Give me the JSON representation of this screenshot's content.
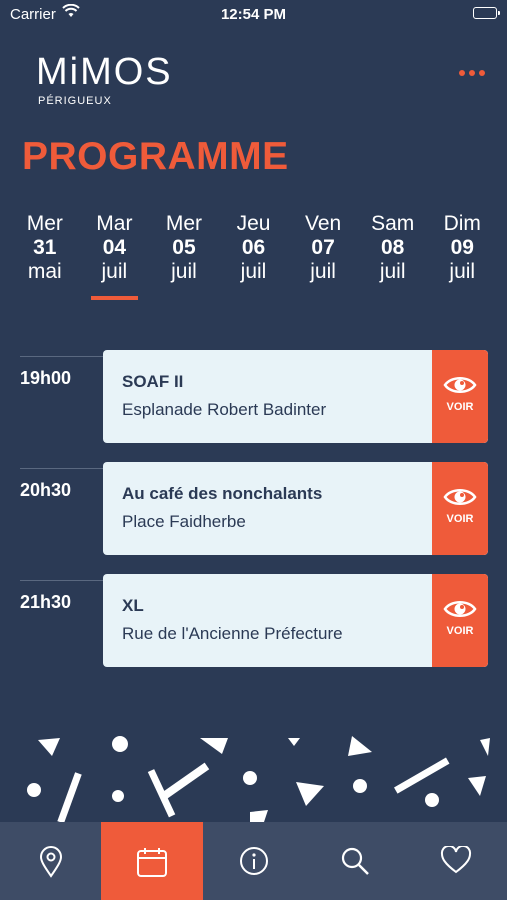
{
  "status_bar": {
    "carrier": "Carrier",
    "time": "12:54 PM"
  },
  "logo": {
    "word": "MiMOS",
    "sub": "PÉRIGUEUX"
  },
  "page_title": "PROGRAMME",
  "days": [
    {
      "dn": "Mer",
      "num": "31",
      "mo": "mai",
      "active": false
    },
    {
      "dn": "Mar",
      "num": "04",
      "mo": "juil",
      "active": true
    },
    {
      "dn": "Mer",
      "num": "05",
      "mo": "juil",
      "active": false
    },
    {
      "dn": "Jeu",
      "num": "06",
      "mo": "juil",
      "active": false
    },
    {
      "dn": "Ven",
      "num": "07",
      "mo": "juil",
      "active": false
    },
    {
      "dn": "Sam",
      "num": "08",
      "mo": "juil",
      "active": false
    },
    {
      "dn": "Dim",
      "num": "09",
      "mo": "juil",
      "active": false
    }
  ],
  "events": [
    {
      "time": "19h00",
      "title": "SOAF II",
      "place": "Esplanade Robert Badinter",
      "action": "VOIR"
    },
    {
      "time": "20h30",
      "title": "Au café des nonchalants",
      "place": "Place Faidherbe",
      "action": "VOIR"
    },
    {
      "time": "21h30",
      "title": "XL",
      "place": "Rue de l'Ancienne Préfecture",
      "action": "VOIR"
    }
  ],
  "tabbar": [
    {
      "icon": "map-pin-icon",
      "active": false
    },
    {
      "icon": "calendar-icon",
      "active": true
    },
    {
      "icon": "info-icon",
      "active": false
    },
    {
      "icon": "search-icon",
      "active": false
    },
    {
      "icon": "heart-icon",
      "active": false
    }
  ],
  "colors": {
    "background": "#2b3a55",
    "accent": "#ef5b3a",
    "card": "#e8f3f8",
    "tabbar": "#3e4c66"
  }
}
